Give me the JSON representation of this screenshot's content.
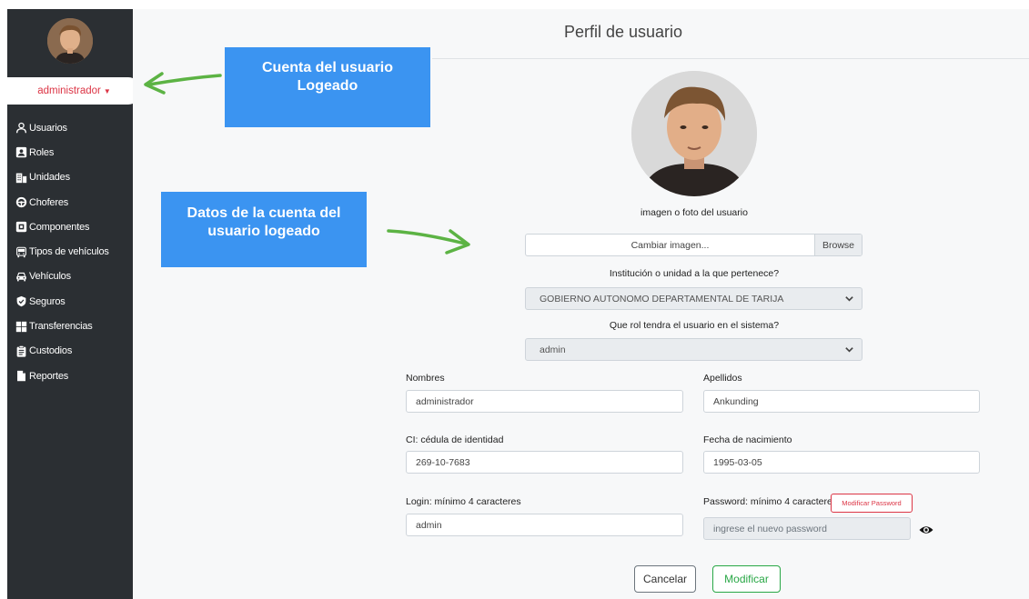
{
  "sidebar": {
    "user_name": "administrador",
    "menu": [
      {
        "label": "Usuarios",
        "icon": "user-icon"
      },
      {
        "label": "Roles",
        "icon": "id-card-icon"
      },
      {
        "label": "Unidades",
        "icon": "building-icon"
      },
      {
        "label": "Choferes",
        "icon": "steering-wheel-icon"
      },
      {
        "label": "Componentes",
        "icon": "component-icon"
      },
      {
        "label": "Tipos de vehículos",
        "icon": "bus-icon"
      },
      {
        "label": "Vehículos",
        "icon": "car-icon"
      },
      {
        "label": "Seguros",
        "icon": "shield-check-icon"
      },
      {
        "label": "Transferencias",
        "icon": "grid-icon"
      },
      {
        "label": "Custodios",
        "icon": "clipboard-icon"
      },
      {
        "label": "Reportes",
        "icon": "file-icon"
      }
    ]
  },
  "page": {
    "title": "Perfil de usuario",
    "photo_label": "imagen o foto del usuario",
    "file_input": {
      "placeholder": "Cambiar imagen...",
      "button": "Browse"
    },
    "institution": {
      "label": "Institución o unidad a la que pertenece?",
      "value": "GOBIERNO AUTONOMO DEPARTAMENTAL DE TARIJA"
    },
    "role": {
      "label": "Que rol tendra el usuario en el sistema?",
      "value": "admin"
    },
    "nombres": {
      "label": "Nombres",
      "value": "administrador"
    },
    "apellidos": {
      "label": "Apellidos",
      "value": "Ankunding"
    },
    "ci": {
      "label": "CI: cédula de identidad",
      "value": "269-10-7683"
    },
    "fecha": {
      "label": "Fecha de nacimiento",
      "value": "1995-03-05"
    },
    "login": {
      "label": "Login: mínimo 4 caracteres",
      "value": "admin"
    },
    "password": {
      "label": "Password: mínimo 4 caracteres",
      "modify_button": "Modificar Password",
      "placeholder": "ingrese el nuevo password"
    },
    "cancel_button": "Cancelar",
    "modify_button": "Modificar"
  },
  "annotations": {
    "logged_account": {
      "line1": "Cuenta del usuario",
      "line2": "Logeado"
    },
    "account_data": {
      "line1": "Datos de la cuenta del",
      "line2": "usuario logeado"
    }
  },
  "colors": {
    "sidebar_bg": "#2b2f33",
    "callout_bg": "#3b94f1",
    "arrow": "#5cb344",
    "danger": "#dc3545",
    "success": "#28a745"
  }
}
